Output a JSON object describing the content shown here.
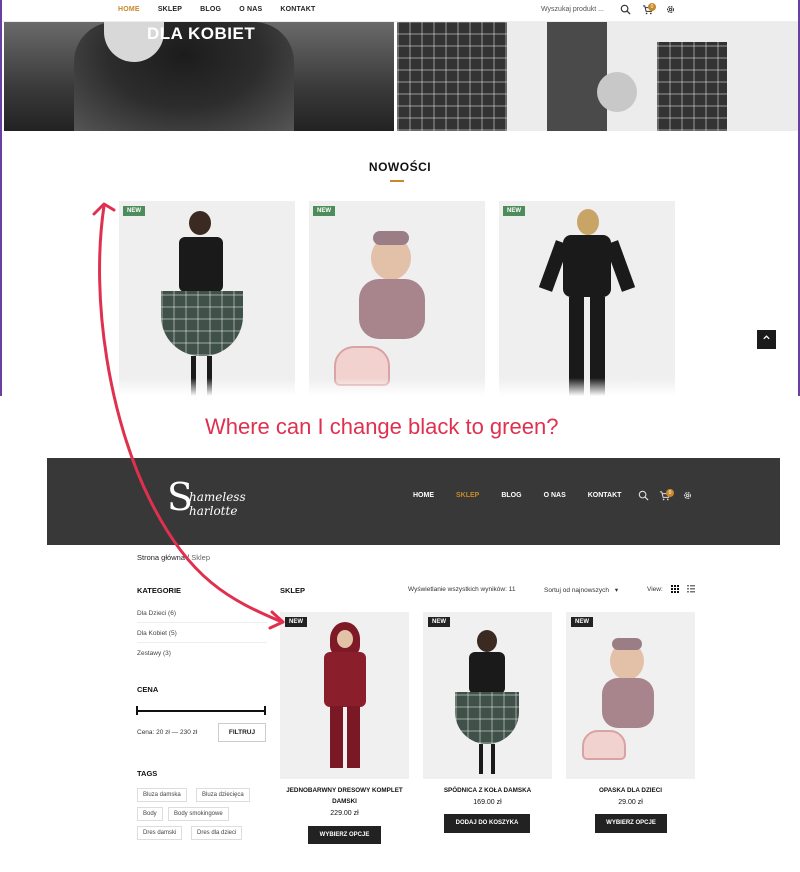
{
  "top": {
    "nav": {
      "items": [
        "HOME",
        "SKLEP",
        "BLOG",
        "O NAS",
        "KONTAKT"
      ],
      "search_placeholder": "Wyszukaj produkt ...",
      "cart_count": "0"
    },
    "hero_title": "DLA KOBIET",
    "section_title": "NOWOŚCI",
    "badge_new": "NEW",
    "accent_color": "#c8892a",
    "badge_color": "#4e8d5b"
  },
  "question": "Where can I change black to green?",
  "bottom": {
    "logo": {
      "line1": "hameless",
      "line2": "harlotte",
      "initials": "S"
    },
    "nav": [
      "HOME",
      "SKLEP",
      "BLOG",
      "O NAS",
      "KONTAKT"
    ],
    "cart_count": "0",
    "breadcrumb": {
      "home": "Strona główna",
      "sep": "/",
      "current": "Sklep"
    },
    "sidebar": {
      "categories_title": "KATEGORIE",
      "categories": [
        "Dla Dzieci (6)",
        "Dla Kobiet (5)",
        "Zestawy (3)"
      ],
      "price_title": "CENA",
      "price_range": "Cena: 20 zł — 230 zł",
      "filter_button": "FILTRUJ",
      "tags_title": "TAGS",
      "tags": [
        "Bluza damska",
        "Bluza dziecięca",
        "Body",
        "Body smokingowe",
        "Dres damski",
        "Dres dla dzieci"
      ]
    },
    "toolbar": {
      "title": "SKLEP",
      "result_count": "Wyświetlanie wszystkich wyników: 11",
      "sort": "Sortuj od najnowszych",
      "view_label": "View:"
    },
    "badge_new": "NEW",
    "badge_color": "#222222",
    "products": [
      {
        "name": "JEDNOBARWNY DRESOWY KOMPLET DAMSKI",
        "price": "229.00 zł",
        "button": "WYBIERZ OPCJE"
      },
      {
        "name": "SPÓDNICA Z KOŁA DAMSKA",
        "price": "169.00 zł",
        "button": "DODAJ DO KOSZYKA"
      },
      {
        "name": "OPASKA DLA DZIECI",
        "price": "29.00 zł",
        "button": "WYBIERZ OPCJE"
      }
    ]
  }
}
